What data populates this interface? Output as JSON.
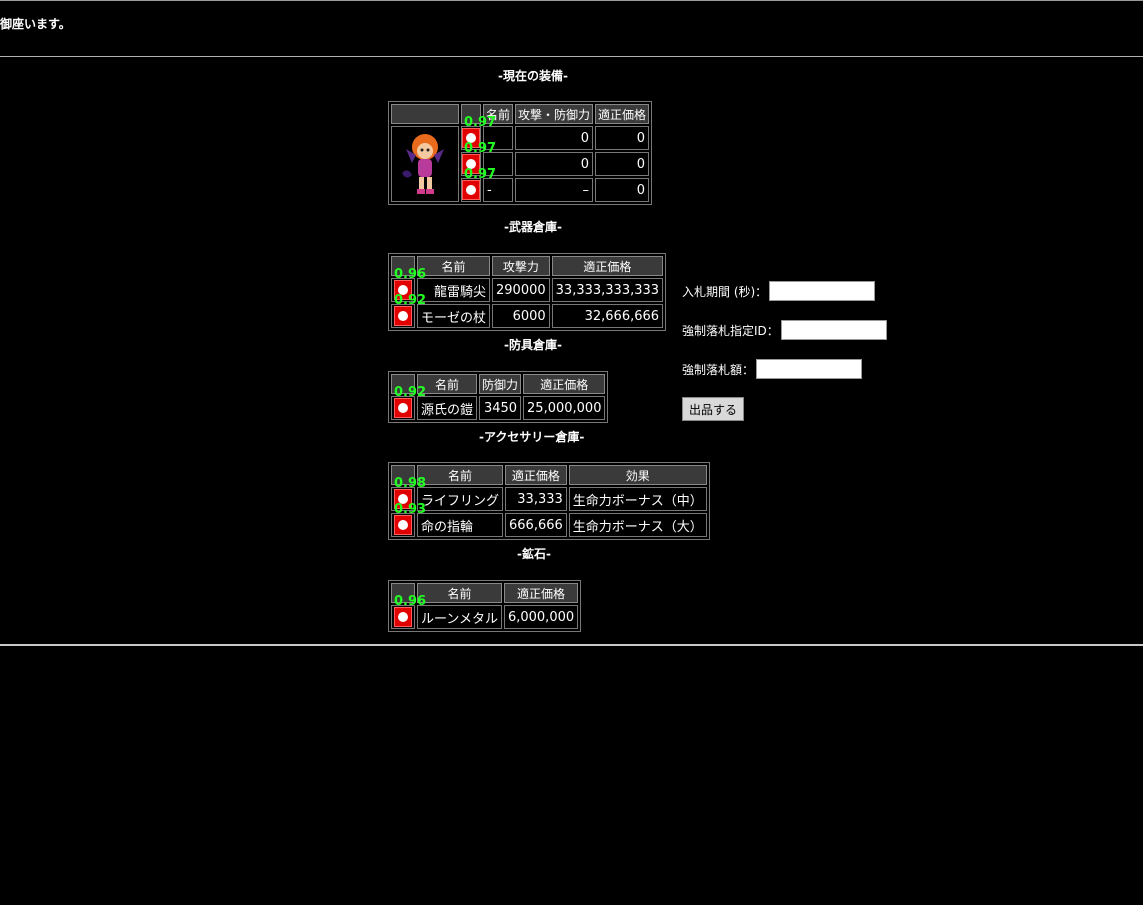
{
  "header": {
    "message": "御座います。"
  },
  "current_equipment": {
    "title": "-現在の装備-",
    "columns": [
      "名前",
      "攻撃・防御力",
      "適正価格"
    ],
    "confidence": "0.97",
    "rows": [
      {
        "name": "",
        "power": "0",
        "price": "0"
      },
      {
        "name": "",
        "power": "0",
        "price": "0"
      },
      {
        "name": "-",
        "power": "–",
        "price": "0"
      }
    ]
  },
  "weapons": {
    "title": "-武器倉庫-",
    "columns": [
      "名前",
      "攻撃力",
      "適正価格"
    ],
    "rows": [
      {
        "confidence": "0.96",
        "name": "龍雷騎尖",
        "power": "290000",
        "price": "33,333,333,333"
      },
      {
        "confidence": "0.92",
        "name": "モーゼの杖",
        "power": "6000",
        "price": "32,666,666"
      }
    ]
  },
  "armor": {
    "title": "-防具倉庫-",
    "columns": [
      "名前",
      "防御力",
      "適正価格"
    ],
    "rows": [
      {
        "confidence": "0.92",
        "name": "源氏の鎧",
        "power": "3450",
        "price": "25,000,000"
      }
    ]
  },
  "accessories": {
    "title": "-アクセサリー倉庫-",
    "columns": [
      "名前",
      "適正価格",
      "効果"
    ],
    "rows": [
      {
        "confidence": "0.98",
        "name": "ライフリング",
        "price": "33,333",
        "effect": "生命力ボーナス（中）"
      },
      {
        "confidence": "0.93",
        "name": "命の指輪",
        "price": "666,666",
        "effect": "生命力ボーナス（大）"
      }
    ]
  },
  "ore": {
    "title": "-鉱石-",
    "columns": [
      "名前",
      "適正価格"
    ],
    "rows": [
      {
        "confidence": "0.96",
        "name": "ルーンメタル",
        "price": "6,000,000"
      }
    ]
  },
  "auction_form": {
    "period_label": "入札期間 (秒)：",
    "period_value": "",
    "forced_id_label": "強制落札指定ID：",
    "forced_id_value": "",
    "forced_amount_label": "強制落札額：",
    "forced_amount_value": "",
    "submit_label": "出品する"
  },
  "colors": {
    "background": "#000000",
    "radio": "#e00000",
    "confidence": "#22ff22"
  }
}
